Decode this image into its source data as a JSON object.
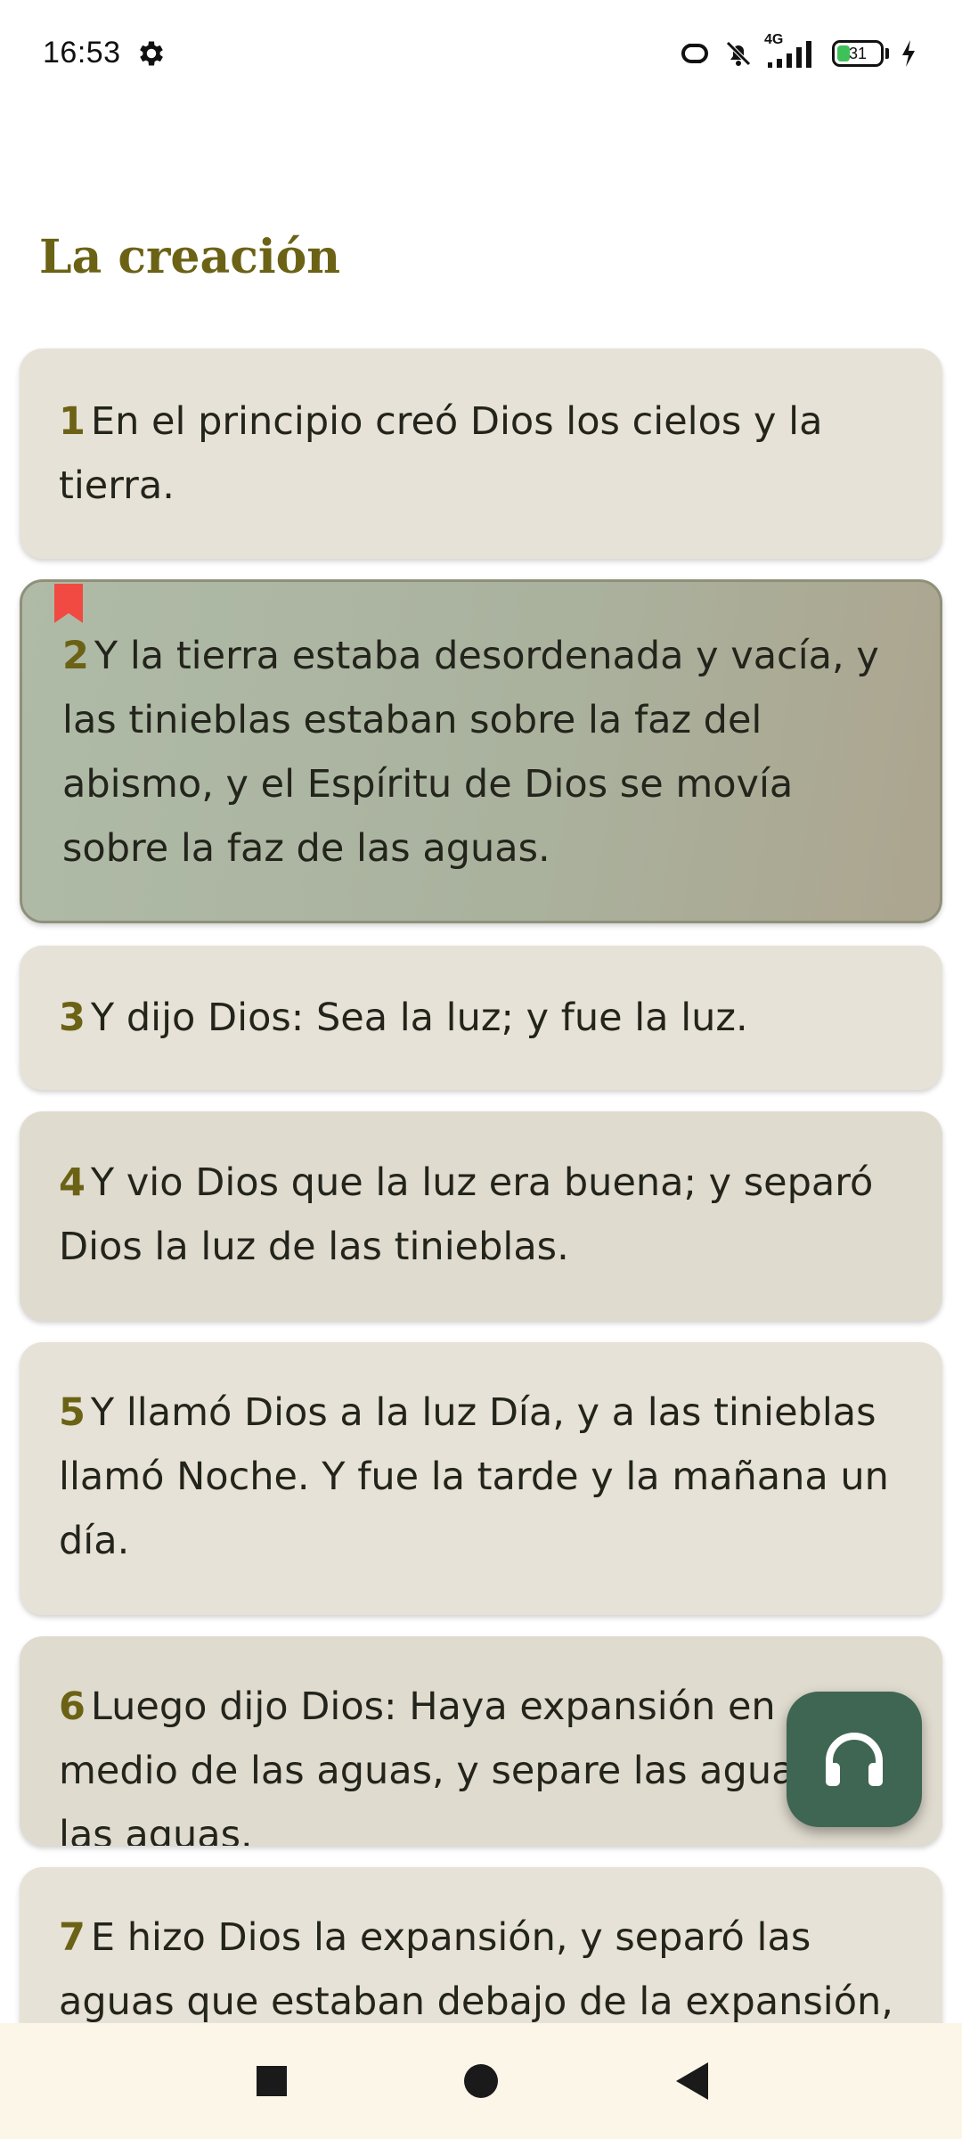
{
  "status_bar": {
    "time": "16:53",
    "battery_level": "31",
    "battery_percent": 31,
    "network_label": "4G",
    "icons": [
      "gear-icon",
      "link-icon",
      "muted-bell-icon",
      "signal-icon",
      "battery-icon",
      "charging-icon"
    ]
  },
  "chapter": {
    "title": "La creación"
  },
  "verses": [
    {
      "number": "1",
      "text": "En el principio creó Dios los cielos y la tierra."
    },
    {
      "number": "2",
      "text": "Y la tierra estaba desordenada y vacía, y las tinieblas estaban sobre la faz del abismo, y el Espíritu de Dios se movía sobre la faz de las aguas.",
      "bookmarked": true,
      "selected": true
    },
    {
      "number": "3",
      "text": "Y dijo Dios: Sea la luz; y fue la luz."
    },
    {
      "number": "4",
      "text": "Y vio Dios que la luz era buena; y separó Dios la luz de las tinieblas."
    },
    {
      "number": "5",
      "text": "Y llamó Dios a la luz Día, y a las tinieblas llamó Noche. Y fue la tarde y la mañana un día."
    },
    {
      "number": "6",
      "text": "Luego dijo Dios: Haya expansión en medio de las aguas, y separe las aguas de las aguas."
    },
    {
      "number": "7",
      "text": "E hizo Dios la expansión, y separó las aguas que estaban debajo de la expansión, de las aguas que estaban sobre la expansión."
    }
  ],
  "fab": {
    "icon": "headphones-icon"
  },
  "nav_bar": {
    "icons": [
      "recents-square-icon",
      "home-circle-icon",
      "back-triangle-icon"
    ]
  },
  "colors": {
    "accent": "#6b6215",
    "card_background": "#e7e2d7",
    "fab_background": "#3f6652",
    "bookmark": "#f04a42",
    "nav_background": "#fcf6e8"
  }
}
